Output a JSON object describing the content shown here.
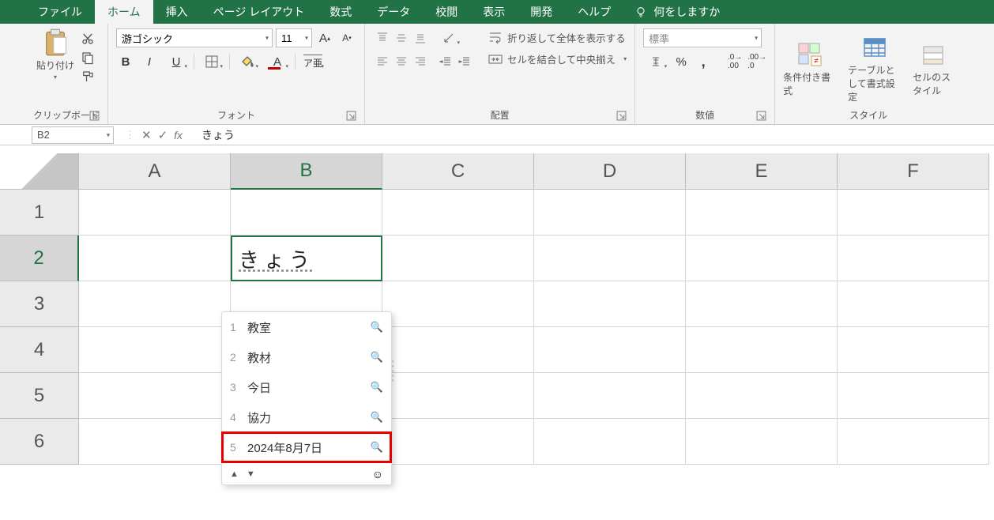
{
  "tabs": {
    "file": "ファイル",
    "home": "ホーム",
    "insert": "挿入",
    "layout": "ページ レイアウト",
    "formulas": "数式",
    "data": "データ",
    "review": "校閲",
    "view": "表示",
    "developer": "開発",
    "help": "ヘルプ",
    "tellme": "何をしますか"
  },
  "ribbon": {
    "clipboard": {
      "label": "クリップボード",
      "paste": "貼り付け"
    },
    "font": {
      "label": "フォント",
      "name": "游ゴシック",
      "size": "11"
    },
    "align": {
      "label": "配置",
      "wrap": "折り返して全体を表示する",
      "merge": "セルを結合して中央揃え"
    },
    "number": {
      "label": "数値",
      "format": "標準"
    },
    "styles": {
      "label": "スタイル",
      "cond": "条件付き書式",
      "table": "テーブルとして書式設定",
      "cell": "セルのスタイル"
    }
  },
  "fbar": {
    "name": "B2",
    "formula": "きょう"
  },
  "cols": [
    "A",
    "B",
    "C",
    "D",
    "E",
    "F"
  ],
  "rows": [
    "1",
    "2",
    "3",
    "4",
    "5",
    "6"
  ],
  "editing": {
    "text": "きょう"
  },
  "ime": {
    "items": [
      {
        "n": "1",
        "t": "教室"
      },
      {
        "n": "2",
        "t": "教材"
      },
      {
        "n": "3",
        "t": "今日"
      },
      {
        "n": "4",
        "t": "協力"
      },
      {
        "n": "5",
        "t": "2024年8月7日"
      }
    ]
  }
}
